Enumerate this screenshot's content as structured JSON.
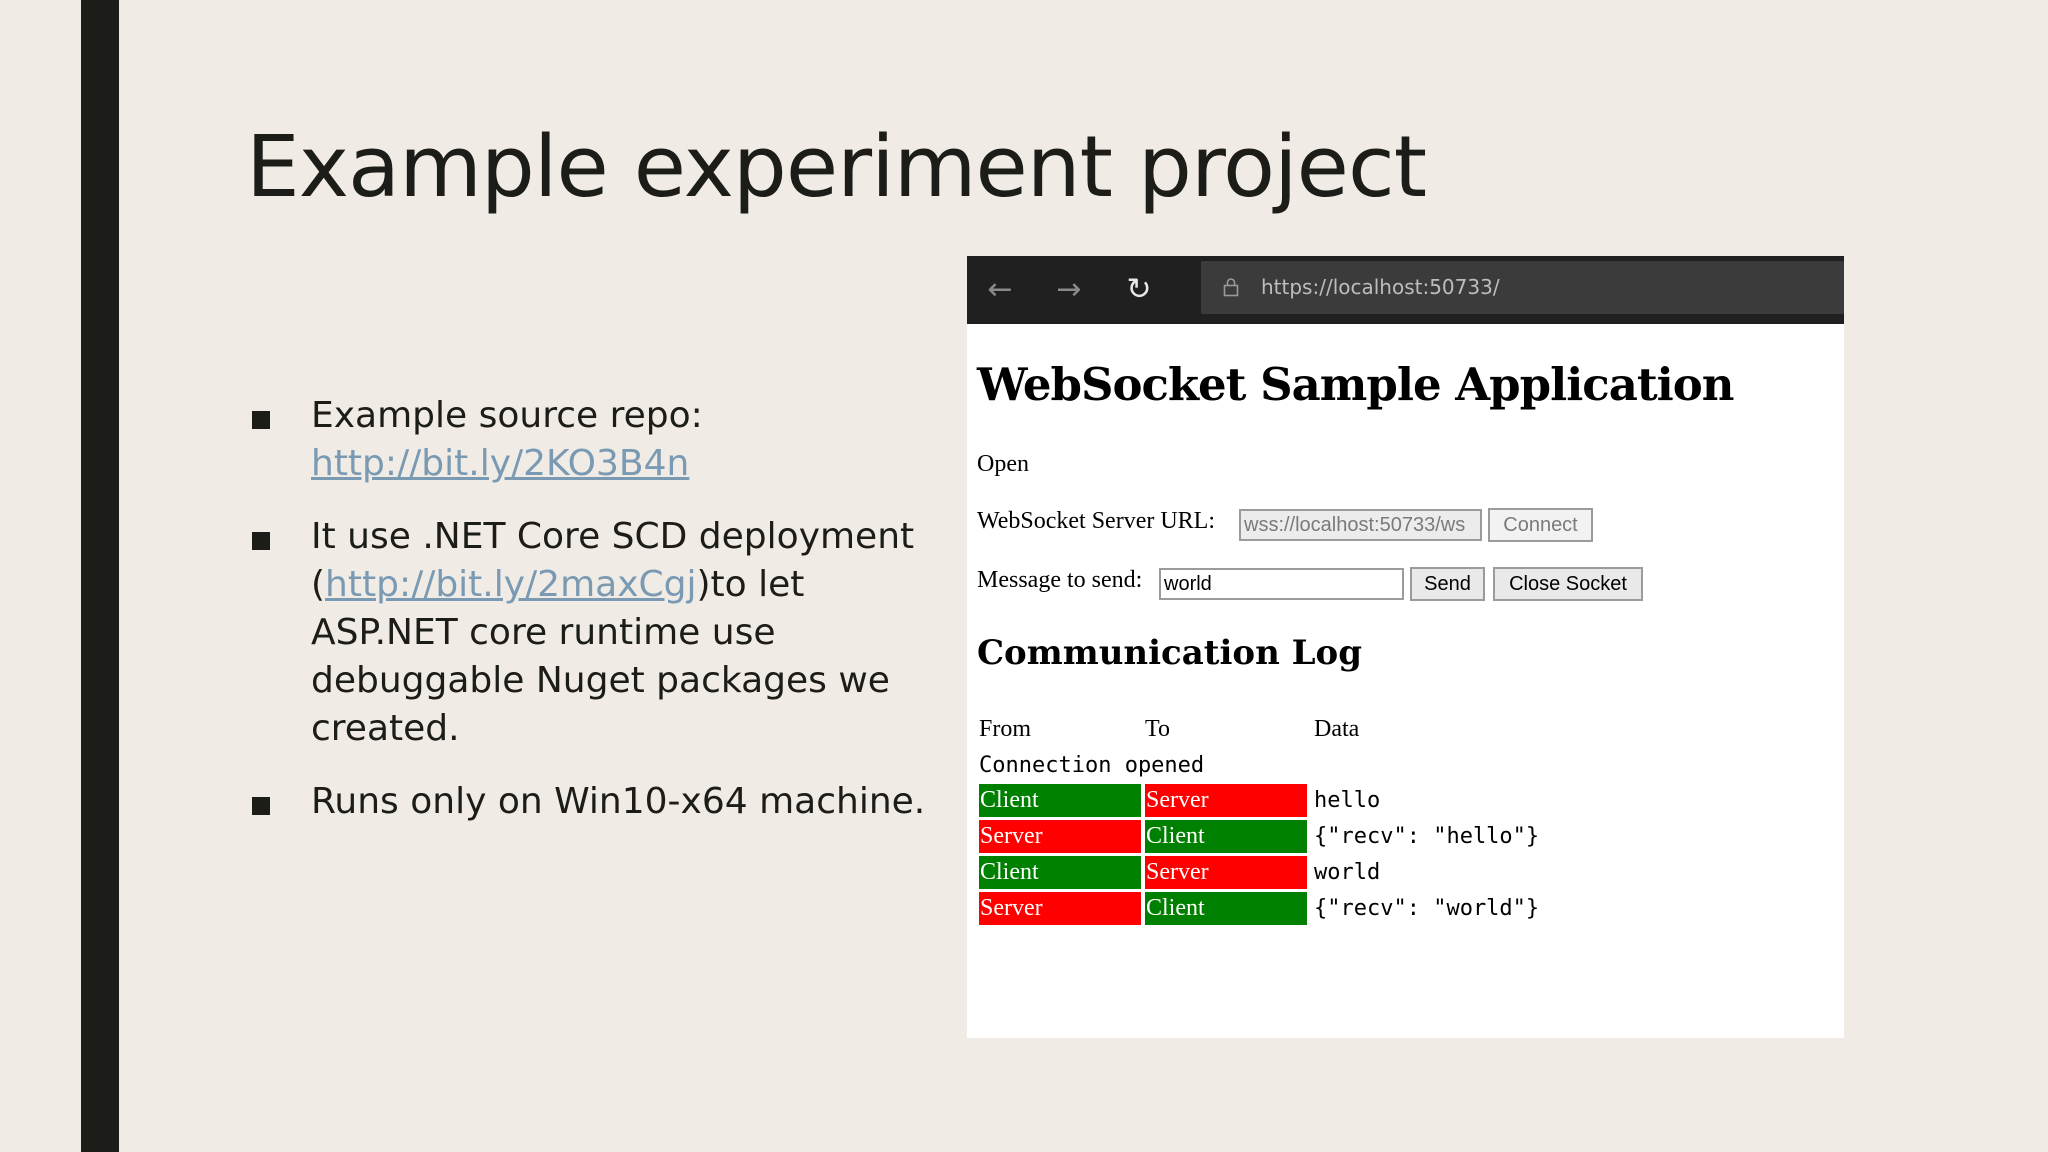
{
  "slide": {
    "title": "Example experiment project",
    "bullets": [
      {
        "text_before": "Example source repo: ",
        "link": "http://bit.ly/2KO3B4n",
        "text_after": ""
      },
      {
        "text_before": "It use .NET Core SCD deployment (",
        "link": "http://bit.ly/2maxCgj",
        "text_after": ")to let ASP.NET core runtime use debuggable Nuget packages we created."
      },
      {
        "text_before": "Runs only on Win10-x64 machine.",
        "link": "",
        "text_after": ""
      }
    ]
  },
  "browser": {
    "address": "https://localhost:50733/",
    "back_icon": "arrow-left-icon",
    "forward_icon": "arrow-right-icon",
    "reload_icon": "reload-icon",
    "lock_icon": "lock-icon",
    "page": {
      "heading": "WebSocket Sample Application",
      "state": "Open",
      "server_url_label": "WebSocket Server URL:",
      "server_url_value": "wss://localhost:50733/ws",
      "connect_label": "Connect",
      "message_label": "Message to send:",
      "message_value": "world",
      "send_label": "Send",
      "close_label": "Close Socket",
      "log_heading": "Communication Log",
      "log_columns": [
        "From",
        "To",
        "Data"
      ],
      "log_note": "Connection opened",
      "log_rows": [
        {
          "from": "Client",
          "to": "Server",
          "data": "hello"
        },
        {
          "from": "Server",
          "to": "Client",
          "data": "{\"recv\": \"hello\"}"
        },
        {
          "from": "Client",
          "to": "Server",
          "data": "world"
        },
        {
          "from": "Server",
          "to": "Client",
          "data": "{\"recv\": \"world\"}"
        }
      ]
    }
  },
  "colors": {
    "client": "#008000",
    "server": "#ff0000",
    "link": "#7a9ab3",
    "background": "#f0ece5",
    "accent_bar": "#1c1c18"
  }
}
